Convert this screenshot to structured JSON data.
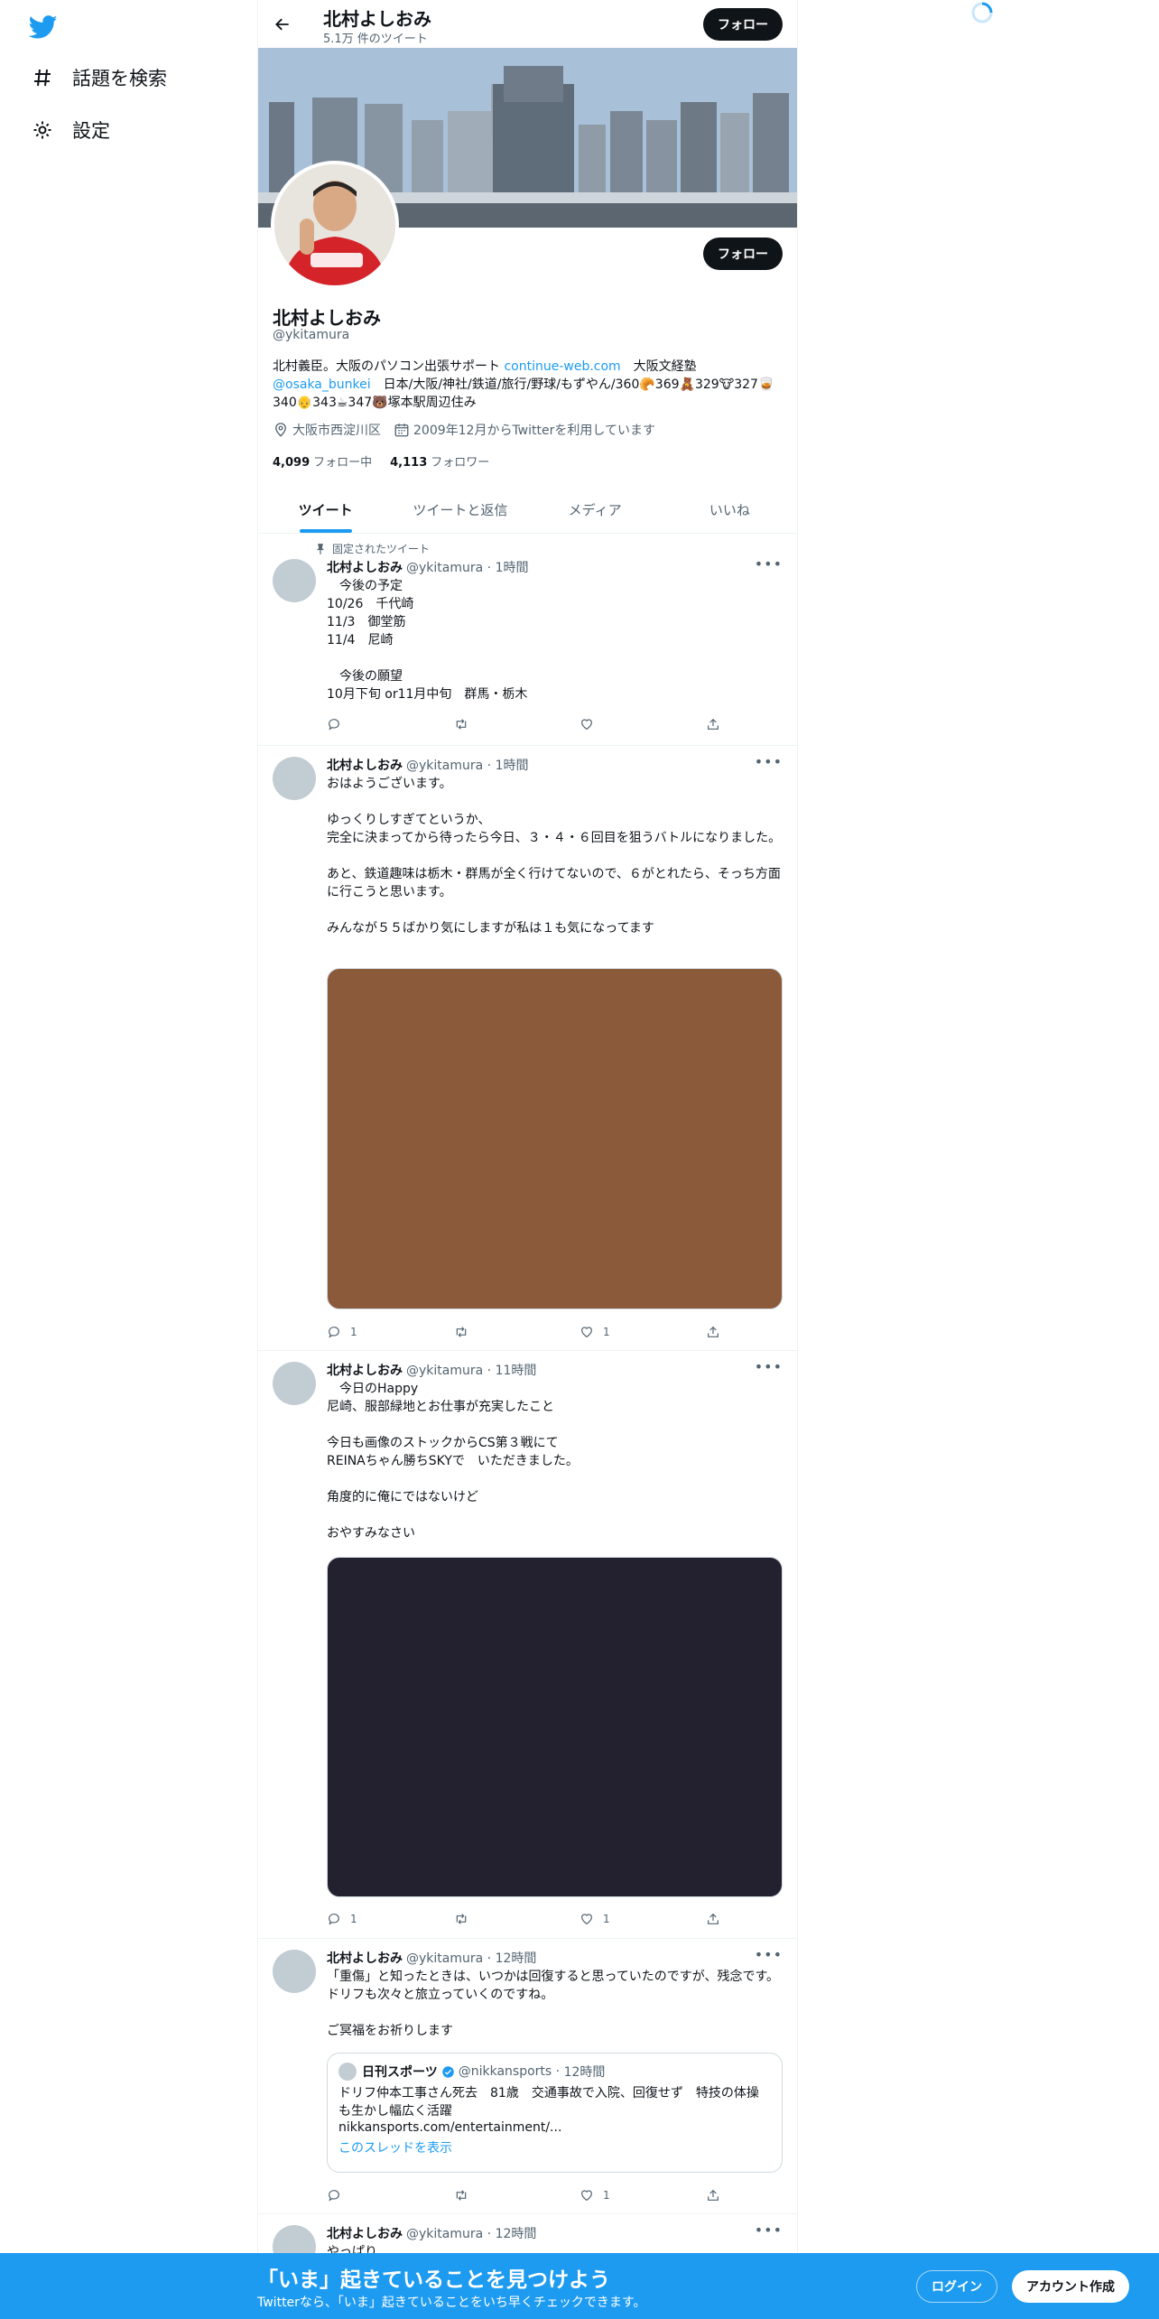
{
  "sidebar": {
    "logo": "twitter-bird-icon",
    "items": [
      {
        "label": "話題を検索",
        "icon": "hashtag-icon"
      },
      {
        "label": "設定",
        "icon": "gear-icon"
      }
    ]
  },
  "header": {
    "name": "北村よしおみ",
    "tweet_count": "5.1万 件のツイート",
    "follow_label": "フォロー"
  },
  "profile": {
    "name": "北村よしおみ",
    "handle": "@ykitamura",
    "follow_label": "フォロー",
    "bio_text1": "北村義臣。大阪のパソコン出張サポート ",
    "bio_link1": "continue-web.com",
    "bio_text2": "　大阪文経塾",
    "bio_link2": "@osaka_bunkei",
    "bio_text3": "　日本/大阪/神社/鉄道/旅行/野球/もずやん/360🥐369🧸329🐮327🥃340👴343☕347🐻塚本駅周辺住み",
    "location": "大阪市西淀川区",
    "joined": "2009年12月からTwitterを利用しています",
    "following_count": "4,099",
    "following_label": "フォロー中",
    "followers_count": "4,113",
    "followers_label": "フォロワー"
  },
  "tabs": [
    {
      "label": "ツイート",
      "active": true
    },
    {
      "label": "ツイートと返信",
      "active": false
    },
    {
      "label": "メディア",
      "active": false
    },
    {
      "label": "いいね",
      "active": false
    }
  ],
  "tweets": [
    {
      "pinned_label": "固定されたツイート",
      "name": "北村よしおみ",
      "handle": "@ykitamura",
      "time": "1時間",
      "text": "　今後の予定\n10/26　千代崎\n11/3　御堂筋\n11/4　尼崎\n\n　今後の願望\n10月下旬 or11月中旬　群馬・栃木",
      "replies": "",
      "retweets": "",
      "likes": ""
    },
    {
      "name": "北村よしおみ",
      "handle": "@ykitamura",
      "time": "1時間",
      "text": "おはようございます。\n\nゆっくりしすぎてというか、\n完全に決まってから待ったら今日、３・４・６回目を狙うバトルになりました。\n\nあと、鉄道趣味は栃木・群馬が全く行けてないので、６がとれたら、そっち方面に行こうと思います。\n\nみんなが５５ばかり気にしますが私は１も気になってます",
      "media_color": "#8b5a3a",
      "replies": "1",
      "retweets": "",
      "likes": "1"
    },
    {
      "name": "北村よしおみ",
      "handle": "@ykitamura",
      "time": "11時間",
      "text": "　今日のHappy\n尼崎、服部緑地とお仕事が充実したこと\n\n今日も画像のストックからCS第３戦にて\nREINAちゃん勝ちSKYで　いただきました。\n\n角度的に俺にではないけど\n\nおやすみなさい",
      "media_color": "#232030",
      "replies": "1",
      "retweets": "",
      "likes": "1"
    },
    {
      "name": "北村よしおみ",
      "handle": "@ykitamura",
      "time": "12時間",
      "text": "「重傷」と知ったときは、いつかは回復すると思っていたのですが、残念です。ドリフも次々と旅立っていくのですね。\n\nご冥福をお祈りします",
      "quote": {
        "name": "日刊スポーツ",
        "handle": "@nikkansports",
        "time": "12時間",
        "text": "ドリフ仲本工事さん死去　81歳　交通事故で入院、回復せず　特技の体操も生かし幅広く活躍",
        "link": "nikkansports.com/entertainment/...",
        "thread_label": "このスレッドを表示"
      },
      "replies": "",
      "retweets": "",
      "likes": "1"
    },
    {
      "name": "北村よしおみ",
      "handle": "@ykitamura",
      "time": "12時間",
      "text": "やっぱり"
    }
  ],
  "bottom_bar": {
    "title": "「いま」起きていることを見つけよう",
    "subtitle": "Twitterなら、「いま」起きていることをいち早くチェックできます。",
    "login_label": "ログイン",
    "signup_label": "アカウント作成"
  },
  "colors": {
    "accent": "#1d9bf0",
    "dark_button": "#0f1419",
    "muted_text": "#536471"
  }
}
